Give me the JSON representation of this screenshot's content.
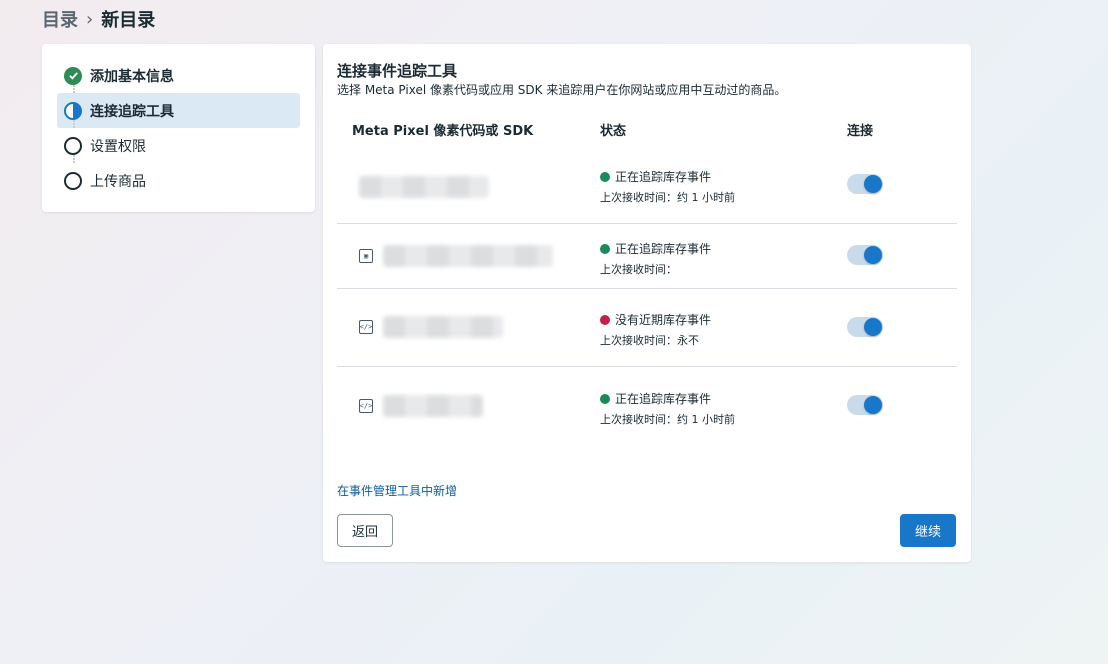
{
  "breadcrumb": {
    "root": "目录",
    "separator": "›",
    "current": "新目录"
  },
  "steps": [
    {
      "label": "添加基本信息",
      "state": "done"
    },
    {
      "label": "连接追踪工具",
      "state": "active"
    },
    {
      "label": "设置权限",
      "state": "todo"
    },
    {
      "label": "上传商品",
      "state": "todo"
    }
  ],
  "main": {
    "title": "连接事件追踪工具",
    "description": "选择 Meta Pixel 像素代码或应用 SDK 来追踪用户在你网站或应用中互动过的商品。",
    "columns": {
      "source": "Meta Pixel 像素代码或 SDK",
      "status": "状态",
      "connect": "连接"
    },
    "rows": [
      {
        "status": "正在追踪库存事件",
        "status_color": "#1a8a5a",
        "last_received": "上次接收时间：约 1 小时前",
        "connected": true,
        "icon": "none-icon"
      },
      {
        "status": "正在追踪库存事件",
        "status_color": "#1a8a5a",
        "last_received": "上次接收时间：",
        "connected": true,
        "icon": "app-icon"
      },
      {
        "status": "没有近期库存事件",
        "status_color": "#c41e4a",
        "last_received": "上次接收时间：永不",
        "connected": true,
        "icon": "code-icon"
      },
      {
        "status": "正在追踪库存事件",
        "status_color": "#1a8a5a",
        "last_received": "上次接收时间：约 1 小时前",
        "connected": true,
        "icon": "code-icon"
      }
    ],
    "add_link": "在事件管理工具中新增",
    "back_label": "返回",
    "continue_label": "继续"
  },
  "colors": {
    "accent": "#1877c9",
    "success": "#1a8a5a",
    "danger": "#c41e4a"
  }
}
